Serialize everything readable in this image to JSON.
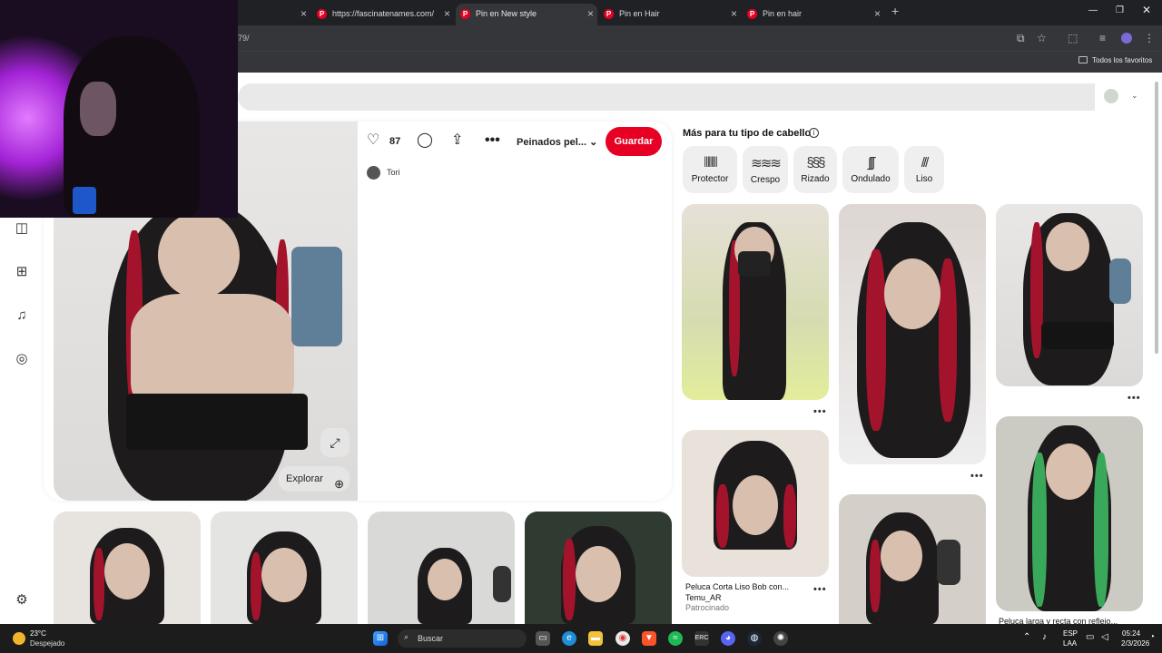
{
  "browser": {
    "tabs": [
      {
        "title": ""
      },
      {
        "title": "https://fascinatenames.com/"
      },
      {
        "title": "Pin en New style"
      },
      {
        "title": "Pin en Hair"
      },
      {
        "title": "Pin en hair"
      }
    ],
    "url_fragment": "79/",
    "bookmarks_label": "Todos los favoritos"
  },
  "pin": {
    "likes": "87",
    "board_select": "Peinados pel...",
    "save_label": "Guardar",
    "author": "Tori",
    "explore_label": "Explorar"
  },
  "more": {
    "title": "Más para tu tipo de cabello",
    "chips": [
      {
        "label": "Protector",
        "icon": "protective-hair-icon"
      },
      {
        "label": "Crespo",
        "icon": "coily-hair-icon"
      },
      {
        "label": "Rizado",
        "icon": "curly-hair-icon"
      },
      {
        "label": "Ondulado",
        "icon": "wavy-hair-icon"
      },
      {
        "label": "Liso",
        "icon": "straight-hair-icon"
      }
    ],
    "ad": {
      "title": "Peluca Corta Liso Bob con...",
      "brand": "Temu_AR",
      "sponsored": "Patrocinado"
    },
    "ad2_title": "Peluca larga y recta con reflejo..."
  },
  "taskbar": {
    "weather_temp": "23°C",
    "weather_desc": "Despejado",
    "search_placeholder": "Buscar",
    "lang1": "ESP",
    "lang2": "LAA",
    "time": "05:24",
    "date": "2/3/2026"
  },
  "colors": {
    "brand_red": "#e60023",
    "browser_dark": "#202124"
  }
}
